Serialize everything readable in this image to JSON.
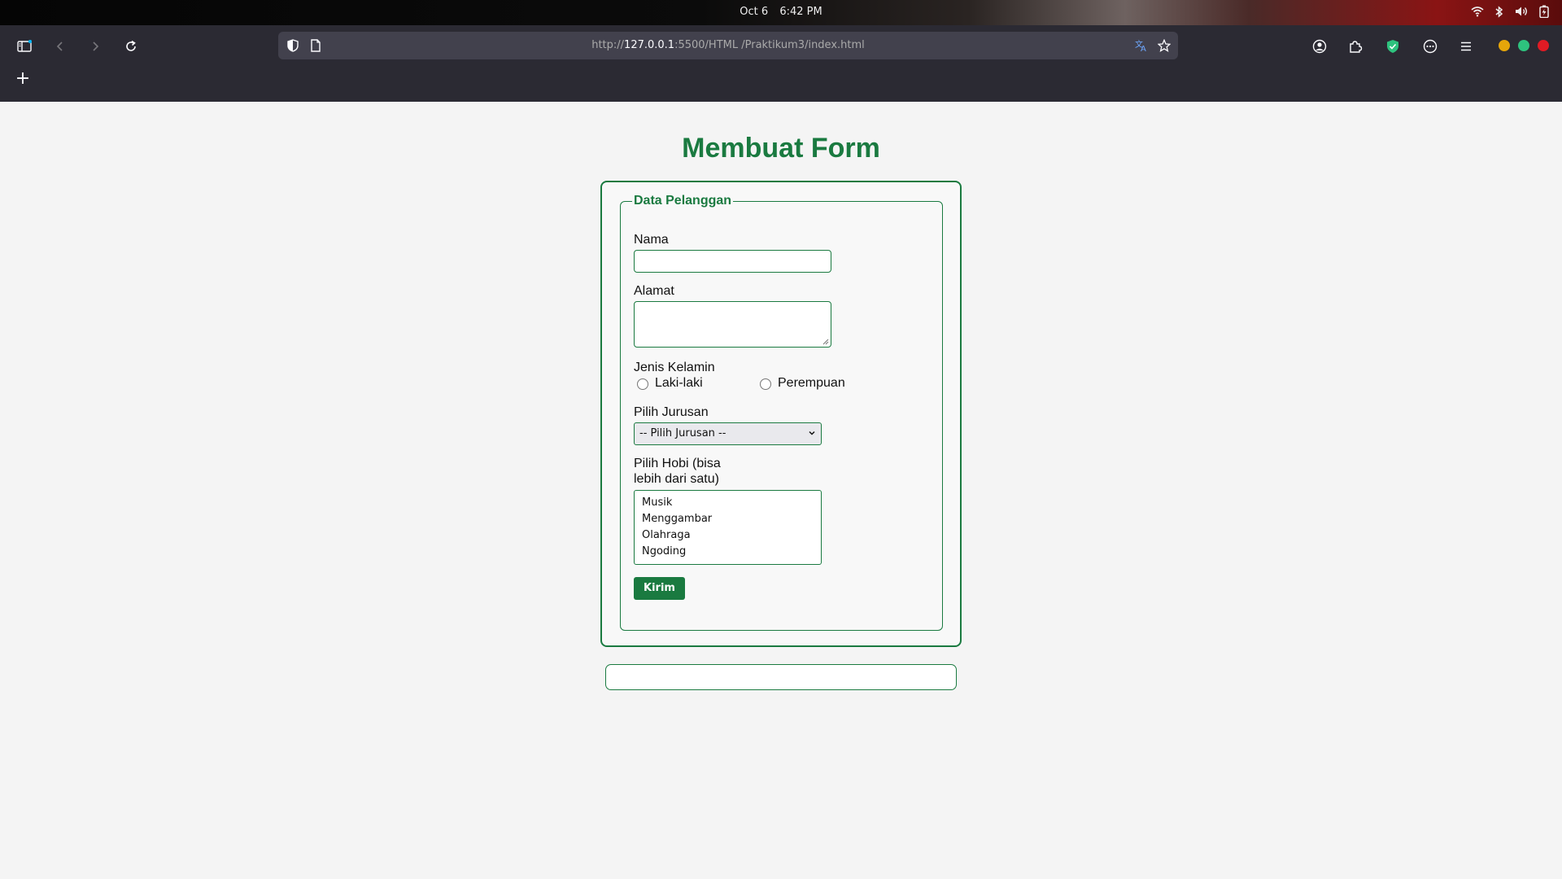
{
  "os": {
    "date": "Oct 6",
    "time": "6:42 PM",
    "tray_icons": [
      "wifi-icon",
      "bluetooth-icon",
      "volume-icon",
      "battery-icon"
    ]
  },
  "browser": {
    "url_prefix": "http://",
    "url_host": "127.0.0.1",
    "url_path": ":5500/HTML /Praktikum3/index.html",
    "new_tab_label": "+",
    "accent_colors": {
      "minimize": "#e5a50a",
      "maximize": "#2ec27e",
      "close": "#e01b24"
    }
  },
  "page": {
    "title": "Membuat Form",
    "accent": "#1a7a40",
    "form": {
      "legend": "Data Pelanggan",
      "nama_label": "Nama",
      "nama_value": "",
      "alamat_label": "Alamat",
      "alamat_value": "",
      "gender_label": "Jenis Kelamin",
      "gender_options": [
        "Laki-laki",
        "Perempuan"
      ],
      "jurusan_label": "Pilih Jurusan",
      "jurusan_selected": "-- Pilih Jurusan --",
      "hobi_label_line1": "Pilih Hobi (bisa",
      "hobi_label_line2": "lebih dari satu)",
      "hobi_options": [
        "Musik",
        "Menggambar",
        "Olahraga",
        "Ngoding"
      ],
      "submit_label": "Kirim"
    },
    "output_text": ""
  }
}
